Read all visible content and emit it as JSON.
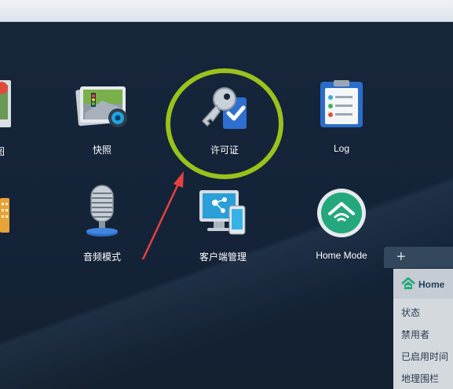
{
  "apps": {
    "snapshot": "快照",
    "license": "许可证",
    "log": "Log",
    "audio_station": "音频模式",
    "client_manager": "客户端管理",
    "home_mode": "Home Mode"
  },
  "partial": {
    "left_label": "图"
  },
  "panel": {
    "add": "+",
    "title": "Home",
    "rows": [
      "状态",
      "禁用者",
      "已启用时间",
      "地理围栏"
    ]
  },
  "colors": {
    "desktop": "#16263a",
    "highlight_circle": "#99c21c",
    "annotation_arrow": "#e84040"
  }
}
